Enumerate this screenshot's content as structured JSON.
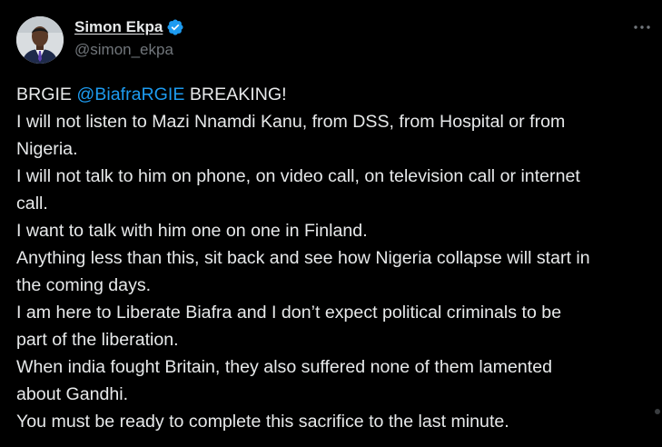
{
  "author": {
    "display_name": "Simon Ekpa",
    "handle": "@simon_ekpa",
    "verified_icon": "verified-badge-icon",
    "avatar_icon": "profile-avatar"
  },
  "menu": {
    "more_icon": "more-horizontal-icon"
  },
  "tweet": {
    "prefix": "BRGIE ",
    "mention": "@BiafraRGIE",
    "first_line_rest": " BREAKING!",
    "lines": [
      "I will not listen to Mazi Nnamdi Kanu, from DSS, from Hospital or from",
      "Nigeria.",
      "I will not talk to him on phone, on video call, on television call or internet",
      "call.",
      "I want to talk with him one on one in Finland.",
      "Anything less than this, sit back and see how Nigeria collapse will start in",
      "the coming days.",
      "I am here to Liberate Biafra and I don’t expect political criminals to be",
      "part of the liberation.",
      "When india fought Britain, they also suffered none of them lamented",
      "about Gandhi.",
      "You must be ready to complete this sacrifice to the last minute."
    ]
  },
  "colors": {
    "background": "#000000",
    "text": "#e7e9ea",
    "secondary_text": "#71767b",
    "accent": "#1d9bf0"
  }
}
